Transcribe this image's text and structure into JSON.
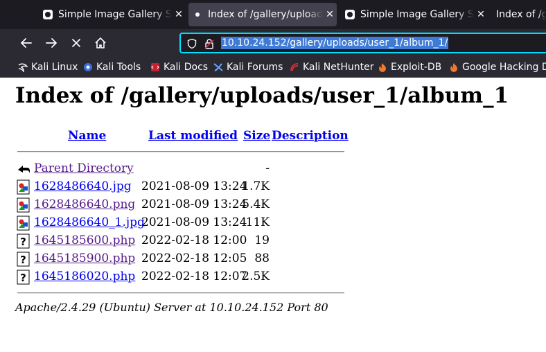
{
  "tabs": [
    {
      "title": "Simple Image Gallery Sys",
      "close": "✕"
    },
    {
      "title": "Index of /gallery/uploads",
      "close": "✕"
    },
    {
      "title": "Simple Image Gallery Sys",
      "close": "✕"
    },
    {
      "title": "Index of /ga"
    }
  ],
  "nav": {
    "url": "10.10.24.152/gallery/uploads/user_1/album_1/"
  },
  "bookmarks": [
    {
      "label": "Kali Linux",
      "icon": "kali-dragon-icon"
    },
    {
      "label": "Kali Tools",
      "icon": "kali-tools-icon"
    },
    {
      "label": "Kali Docs",
      "icon": "kali-docs-icon"
    },
    {
      "label": "Kali Forums",
      "icon": "kali-forums-icon"
    },
    {
      "label": "Kali NetHunter",
      "icon": "kali-nethunter-icon"
    },
    {
      "label": "Exploit-DB",
      "icon": "exploit-db-icon"
    },
    {
      "label": "Google Hacking DB",
      "icon": "ghdb-icon"
    }
  ],
  "page": {
    "heading": "Index of /gallery/uploads/user_1/album_1",
    "columns": {
      "name": "Name",
      "modified": "Last modified",
      "size": "Size",
      "description": "Description"
    },
    "parent": {
      "name": "Parent Directory",
      "size": "-"
    },
    "files": [
      {
        "name": "1628486640.jpg",
        "modified": "2021-08-09 13:24",
        "size": "1.7K",
        "type": "image"
      },
      {
        "name": "1628486640.png",
        "modified": "2021-08-09 13:24",
        "size": "5.4K",
        "type": "image"
      },
      {
        "name": "1628486640_1.jpg",
        "modified": "2021-08-09 13:24",
        "size": "11K",
        "type": "image"
      },
      {
        "name": "1645185600.php",
        "modified": "2022-02-18 12:00",
        "size": "19",
        "type": "unknown"
      },
      {
        "name": "1645185900.php",
        "modified": "2022-02-18 12:05",
        "size": "88",
        "type": "unknown"
      },
      {
        "name": "1645186020.php",
        "modified": "2022-02-18 12:07",
        "size": "2.5K",
        "type": "unknown"
      }
    ],
    "address": "Apache/2.4.29 (Ubuntu) Server at 10.10.24.152 Port 80"
  },
  "colors": {
    "url_highlight": "#3d7bd6",
    "focus_ring": "#00ddff",
    "link": "#0000ee",
    "visited": "#551a8b"
  }
}
